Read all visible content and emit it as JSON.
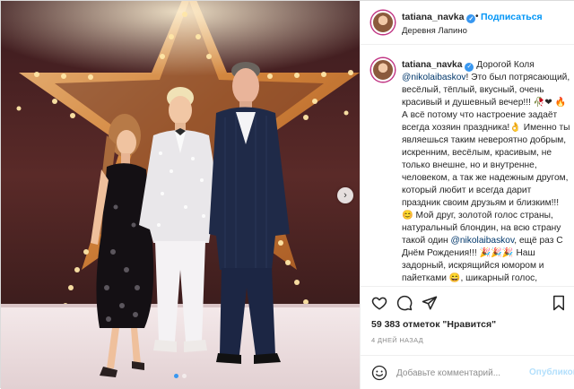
{
  "colors": {
    "accent": "#0095f6",
    "verified": "#3897f0",
    "publish_disabled": "#b2dffc",
    "muted": "#8e8e8e"
  },
  "header": {
    "username": "tatiana_navka",
    "separator": "•",
    "follow_label": "Подписаться",
    "location": "Деревня Лапино"
  },
  "caption": {
    "username": "tatiana_navka",
    "p1": "Дорогой Коля",
    "m1": "@nikolaibaskov",
    "p2": "! Это был потрясающий, весёлый, тёплый, вкусный, очень красивый и душевный вечер!!!",
    "e1": "🥀❤",
    "e2": "🔥",
    "p3": "А всё потому что настроение задаёт всегда хозяин праздника!",
    "e3": "👌",
    "p4": "Именно ты являешься таким невероятно добрым, искренним, весёлым, красивым, не только внешне, но и внутренне, человеком, а так же надежным другом, который любит и всегда дарит праздник своим друзьям и близким!!!",
    "e4": "😊",
    "p5": "Мой друг, золотой голос страны, натуральный блондин, на всю страну такой один",
    "m2": "@nikolaibaskov",
    "p6": ", ещё раз С Днём Рождения!!!",
    "e5": "🎉🎉🎉",
    "p7": "Наш задорный, искрящийся юмором и пайетками",
    "e6": "😄",
    "p8": ", шикарный голос, невероятный артист"
  },
  "icons": {
    "like": "heart-icon",
    "comment": "comment-icon",
    "share": "share-icon",
    "save": "bookmark-icon",
    "emoji": "emoji-icon",
    "next": "chevron-right-icon"
  },
  "stats": {
    "likes": "59 383 отметок \"Нравится\"",
    "time": "4 ДНЕЙ НАЗАД"
  },
  "comment": {
    "placeholder": "Добавьте комментарий...",
    "publish_label": "Опубликовать"
  },
  "carousel": {
    "slides": 2,
    "active": 1
  }
}
